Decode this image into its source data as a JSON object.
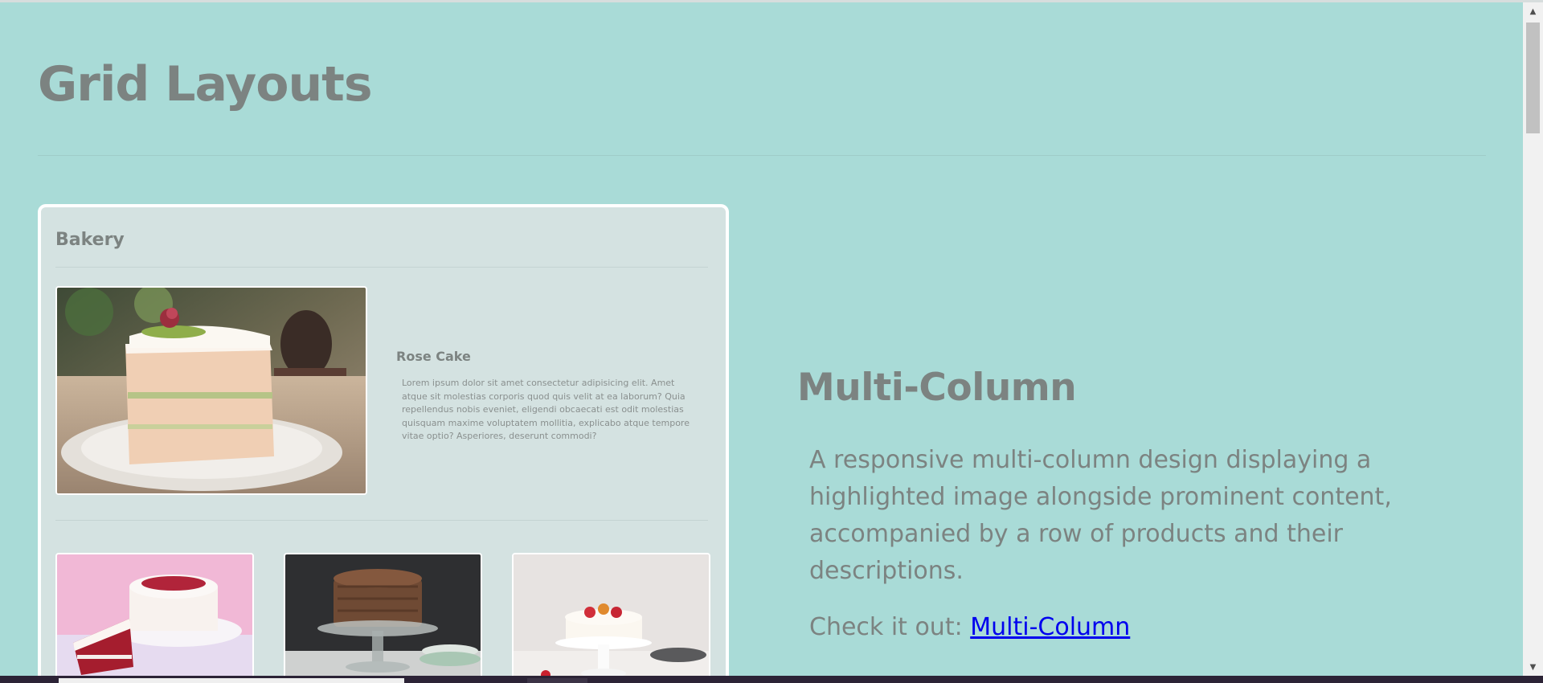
{
  "page": {
    "title": "Grid Layouts"
  },
  "card": {
    "title": "Bakery",
    "hero": {
      "title": "Rose Cake",
      "description": "Lorem ipsum dolor sit amet consectetur adipisicing elit. Amet atque sit molestias corporis quod quis velit at ea laborum? Quia repellendus nobis eveniet, eligendi obcaecati est odit molestias quisquam maxime voluptatem mollitia, explicabo atque tempore vitae optio? Asperiores, deserunt commodi?"
    },
    "products": [
      {
        "name": "red-velvet-cake-image"
      },
      {
        "name": "chocolate-cake-image"
      },
      {
        "name": "berry-cheesecake-image"
      }
    ]
  },
  "side": {
    "title": "Multi-Column",
    "description": "A responsive multi-column design displaying a highlighted image alongside prominent content, accompanied by a row of products and their descriptions.",
    "cta_prefix": "Check it out: ",
    "cta_link": "Multi-Column"
  },
  "colors": {
    "background": "#a9dbd7",
    "card_background": "#d4e2e1",
    "heading": "#7c8381",
    "link": "#0000ee"
  }
}
